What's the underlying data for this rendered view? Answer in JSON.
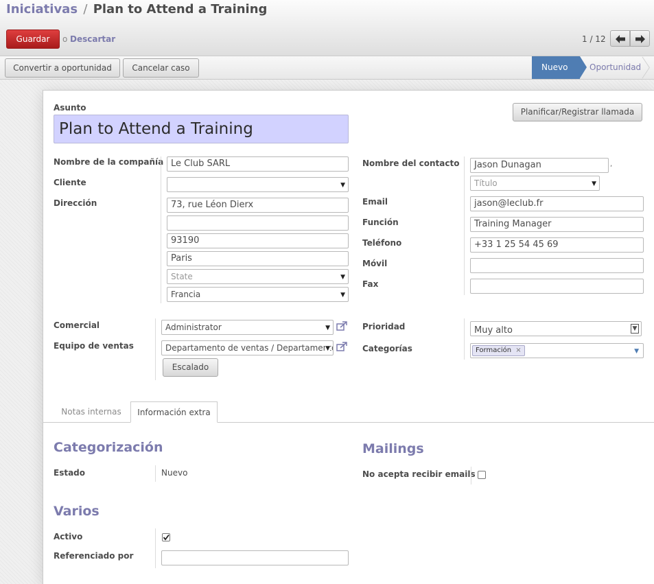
{
  "header": {
    "breadcrumb_parent": "Iniciativas",
    "breadcrumb_sep": "/",
    "breadcrumb_current": "Plan to Attend a Training",
    "save_label": "Guardar",
    "or_text": "o",
    "discard_label": "Descartar",
    "pager": "1 / 12"
  },
  "statusbar": {
    "convert_label": "Convertir a oportunidad",
    "cancel_label": "Cancelar caso",
    "stages": [
      "Nuevo",
      "Oportunidad"
    ]
  },
  "form": {
    "subject_label": "Asunto",
    "subject_value": "Plan to Attend a Training",
    "schedule_call_label": "Planificar/Registrar llamada",
    "company_label": "Nombre de la compañía",
    "company_value": "Le Club SARL",
    "customer_label": "Cliente",
    "customer_value": "",
    "address_label": "Dirección",
    "street": "73, rue Léon Dierx",
    "street2": "",
    "zip": "93190",
    "city": "Paris",
    "state_placeholder": "State",
    "country": "Francia",
    "contact_name_label": "Nombre del contacto",
    "contact_name_value": "Jason Dunagan",
    "title_placeholder": "Título",
    "email_label": "Email",
    "email_value": "jason@leclub.fr",
    "function_label": "Función",
    "function_value": "Training Manager",
    "phone_label": "Teléfono",
    "phone_value": "+33 1 25 54 45 69",
    "mobile_label": "Móvil",
    "mobile_value": "",
    "fax_label": "Fax",
    "fax_value": "",
    "salesperson_label": "Comercial",
    "salesperson_value": "Administrator",
    "sales_team_label": "Equipo de ventas",
    "sales_team_value": "Departamento de ventas / Departamento",
    "escalate_label": "Escalado",
    "priority_label": "Prioridad",
    "priority_value": "Muy alto",
    "categories_label": "Categorías",
    "category_tag": "Formación",
    "tag_remove": "×"
  },
  "tabs": [
    "Notas internas",
    "Información extra"
  ],
  "extra": {
    "categorization_title": "Categorización",
    "state_label": "Estado",
    "state_value": "Nuevo",
    "mailings_title": "Mailings",
    "opt_out_label": "No acepta recibir emails",
    "opt_out_checked": false,
    "misc_title": "Varios",
    "active_label": "Activo",
    "active_checked": true,
    "referred_label": "Referenciado por",
    "referred_value": ""
  },
  "icons": {
    "prev": "arrow-left-icon",
    "next": "arrow-right-icon",
    "external": "external-link-icon",
    "dropdown": "chevron-down-icon"
  },
  "colors": {
    "primary_button": "#c42323",
    "link": "#7c7bad",
    "active_stage": "#4f7db3",
    "subject_bg": "#d2d2ff"
  }
}
